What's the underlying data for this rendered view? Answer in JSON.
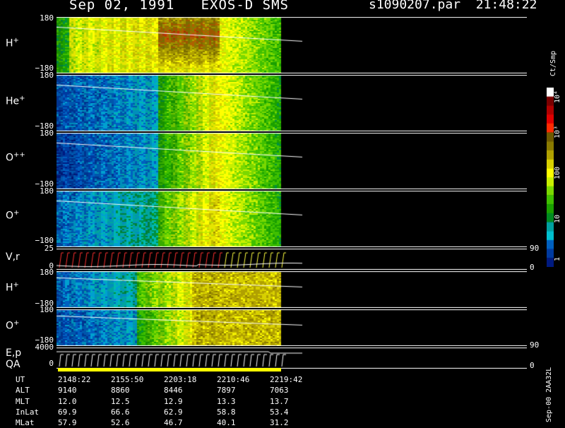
{
  "header": {
    "title": "Sep 02, 1991   EXOS-D SMS",
    "file": "s1090207.par  21:48:22"
  },
  "panels": [
    {
      "id": "hplus1",
      "label": "H",
      "sup": "+",
      "top_tick": "180",
      "bottom_tick": "−180",
      "palette": "hplus"
    },
    {
      "id": "heplus",
      "label": "He",
      "sup": "+",
      "top_tick": "180",
      "bottom_tick": "−180",
      "palette": "cool"
    },
    {
      "id": "opp",
      "label": "O",
      "sup": "++",
      "top_tick": "180",
      "bottom_tick": "−180",
      "palette": "cool"
    },
    {
      "id": "oplus1",
      "label": "O",
      "sup": "+",
      "top_tick": "180",
      "bottom_tick": "−180",
      "palette": "cool"
    },
    {
      "id": "vr",
      "label": "V,r",
      "sup": "",
      "top_tick": "25",
      "bottom_tick": "0",
      "right_top": "90",
      "right_bottom": "0"
    },
    {
      "id": "hplus2",
      "label": "H",
      "sup": "+",
      "top_tick": "180",
      "bottom_tick": "−180",
      "palette": "cool2"
    },
    {
      "id": "oplus2",
      "label": "O",
      "sup": "+",
      "top_tick": "180",
      "bottom_tick": "−180",
      "palette": "cool3"
    },
    {
      "id": "ep",
      "label": "E,p",
      "label2": "QA",
      "sup": "",
      "top_tick": "4000",
      "bottom_tick": "0",
      "right_top": "90",
      "right_bottom": "0"
    }
  ],
  "footer": {
    "rows": [
      {
        "name": "UT",
        "values": [
          "2148:22",
          "2155:50",
          "2203:18",
          "2210:46",
          "2219:42"
        ]
      },
      {
        "name": "ALT",
        "values": [
          "9140",
          "8860",
          "8446",
          "7897",
          "7063"
        ]
      },
      {
        "name": "MLT",
        "values": [
          "12.0",
          "12.5",
          "12.9",
          "13.3",
          "13.7"
        ]
      },
      {
        "name": "InLat",
        "values": [
          "69.9",
          "66.6",
          "62.9",
          "58.8",
          "53.4"
        ]
      },
      {
        "name": "MLat",
        "values": [
          "57.9",
          "52.6",
          "46.7",
          "40.1",
          "31.2"
        ]
      }
    ]
  },
  "colorbar": {
    "unit": "Ct/Smp",
    "ticks": [
      "10⁴",
      "10³",
      "100",
      "10",
      "1"
    ],
    "colors": [
      "#ffffff",
      "#7a0000",
      "#b00000",
      "#e00000",
      "#ff2a00",
      "#6e5a00",
      "#8a7a00",
      "#b0a000",
      "#d8d000",
      "#ffff00",
      "#c8f000",
      "#7ad800",
      "#3fbf00",
      "#1aa000",
      "#008a20",
      "#00a0a0",
      "#00c0d0",
      "#0060c0",
      "#003aa0",
      "#001a80"
    ]
  },
  "version": "Sep-00  2AA32L",
  "colors": {
    "background": "#000000",
    "axes": "#ffffff",
    "quality_bar": "#ffff00"
  }
}
